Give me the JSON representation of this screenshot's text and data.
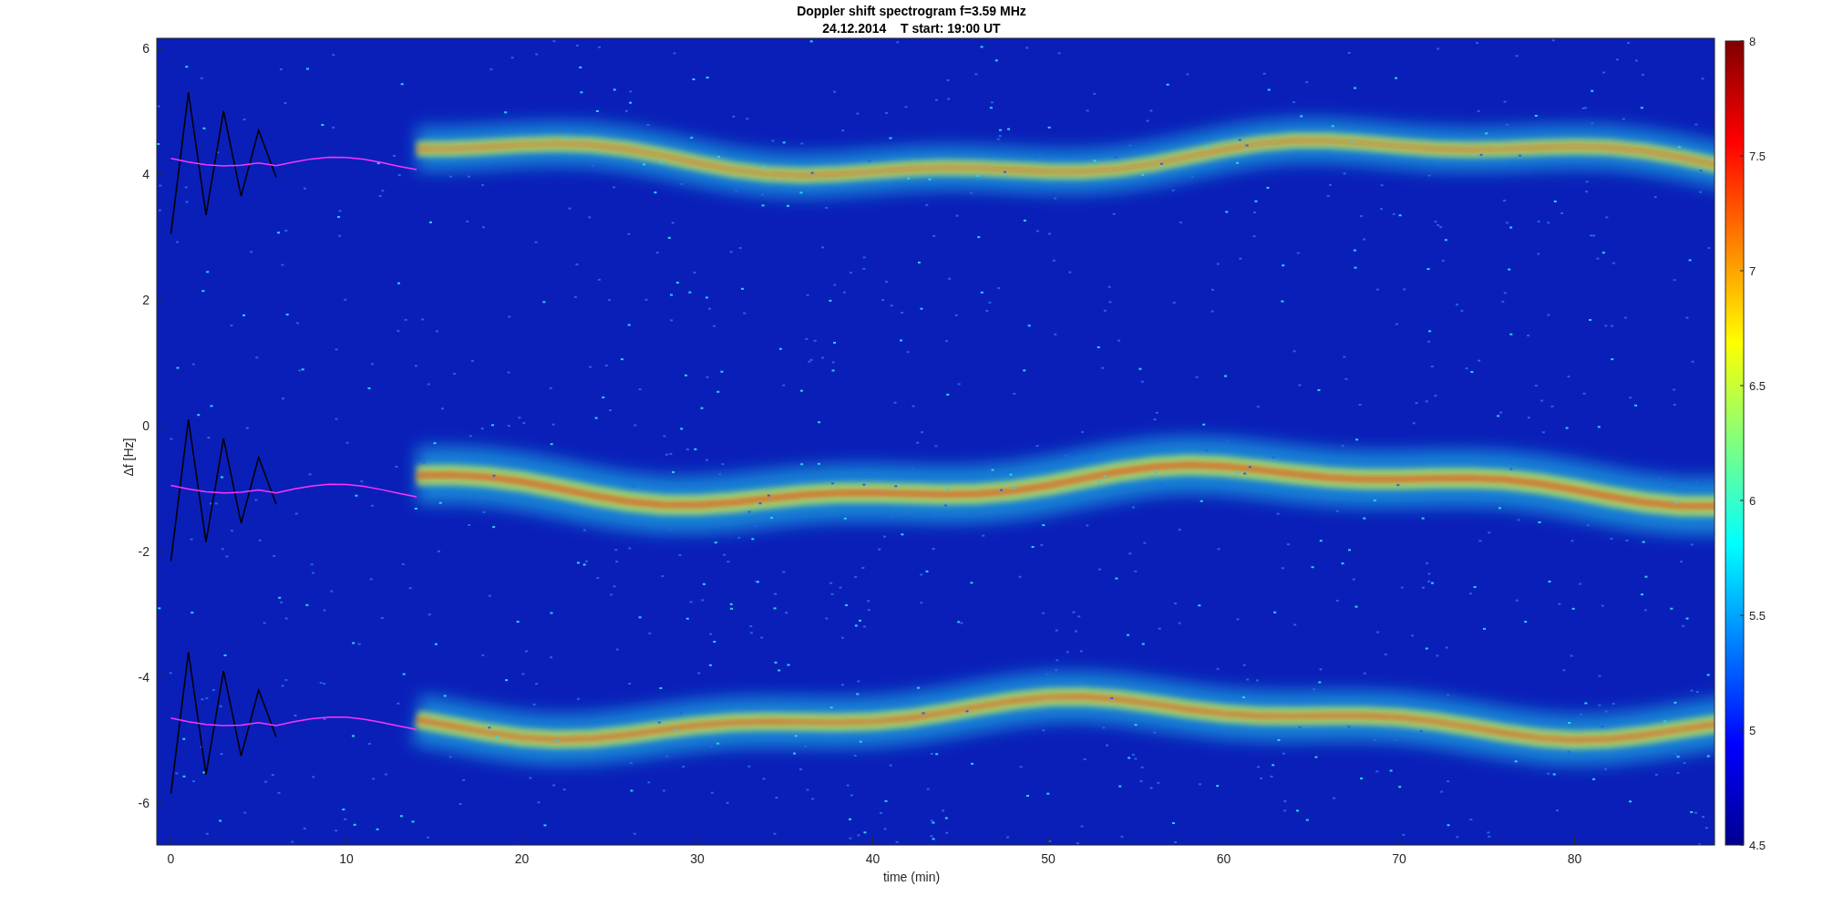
{
  "title": {
    "line_1": "Doppler shift spectrogram f=3.59 MHz",
    "line_2": "24.12.2014    T start: 19:00 UT"
  },
  "axes": {
    "xlabel": "time (min)",
    "ylabel": "Δf [Hz]",
    "xticks": [
      "0",
      "10",
      "20",
      "30",
      "40",
      "50",
      "60",
      "70",
      "80"
    ],
    "yticks": [
      "6",
      "4",
      "2",
      "0",
      "-2",
      "-4",
      "-6"
    ]
  },
  "colorbar": {
    "ticks": [
      "8",
      "7.5",
      "7",
      "6.5",
      "6",
      "5.5",
      "5",
      "4.5"
    ]
  }
}
